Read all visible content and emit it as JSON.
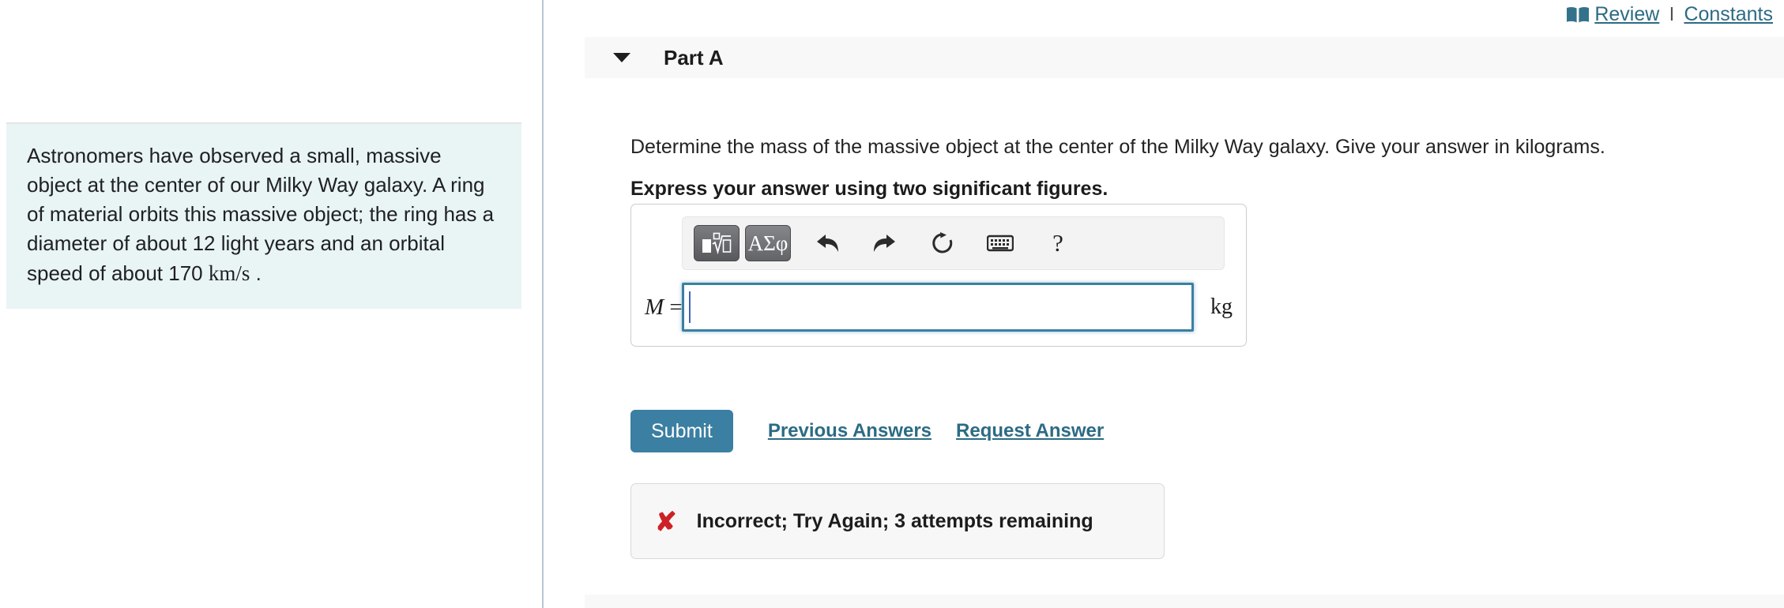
{
  "utility_bar": {
    "book_icon": "book-icon",
    "review_label": "Review",
    "separator": "l",
    "constants_label": "Constants",
    "link_color": "#2c6b84"
  },
  "left_pane": {
    "problem_text_part1": "Astronomers have observed a small, massive object at the center of our Milky Way galaxy. A ring of material orbits this massive object; the ring has a diameter of about 12 light years and an orbital speed of about 170 ",
    "problem_unit": "km/s",
    "problem_text_part2": " .",
    "background_color": "#e9f4f5"
  },
  "part": {
    "caret_icon": "chevron-down-icon",
    "title": "Part A",
    "header_background": "#f8f8f8"
  },
  "question": {
    "prompt": "Determine the mass of the massive object at the center of the Milky Way galaxy. Give your answer in kilograms.",
    "instruction": "Express your answer using two significant figures."
  },
  "answer_widget": {
    "toolbar": [
      {
        "name": "math-template-button",
        "label": "",
        "icon": "square-root-template-icon",
        "type": "template"
      },
      {
        "name": "greek-symbols-button",
        "label": "ΑΣφ",
        "icon": "greek-letters-icon",
        "type": "greek"
      },
      {
        "name": "undo-button",
        "label": "",
        "icon": "undo-arrow-icon",
        "type": "icon"
      },
      {
        "name": "redo-button",
        "label": "",
        "icon": "redo-arrow-icon",
        "type": "icon"
      },
      {
        "name": "reset-button",
        "label": "",
        "icon": "reset-circular-arrow-icon",
        "type": "icon"
      },
      {
        "name": "keyboard-button",
        "label": "",
        "icon": "keyboard-icon",
        "type": "icon"
      },
      {
        "name": "help-button",
        "label": "?",
        "icon": "question-mark-icon",
        "type": "help"
      }
    ],
    "variable_label": "M",
    "equals_sign": "=",
    "input_value": "",
    "input_placeholder": "",
    "unit_label": "kg",
    "focus_border_color": "#3b7fa2",
    "caret_color": "#4264b8"
  },
  "actions": {
    "submit_label": "Submit",
    "submit_color": "#3b7fa2",
    "previous_answers_label": "Previous Answers",
    "request_answer_label": "Request Answer"
  },
  "feedback": {
    "icon": "red-x-icon",
    "cross_glyph": "✘",
    "message": "Incorrect; Try Again; 3 attempts remaining",
    "icon_color": "#cc2127",
    "background_color": "#f7f7f7"
  }
}
